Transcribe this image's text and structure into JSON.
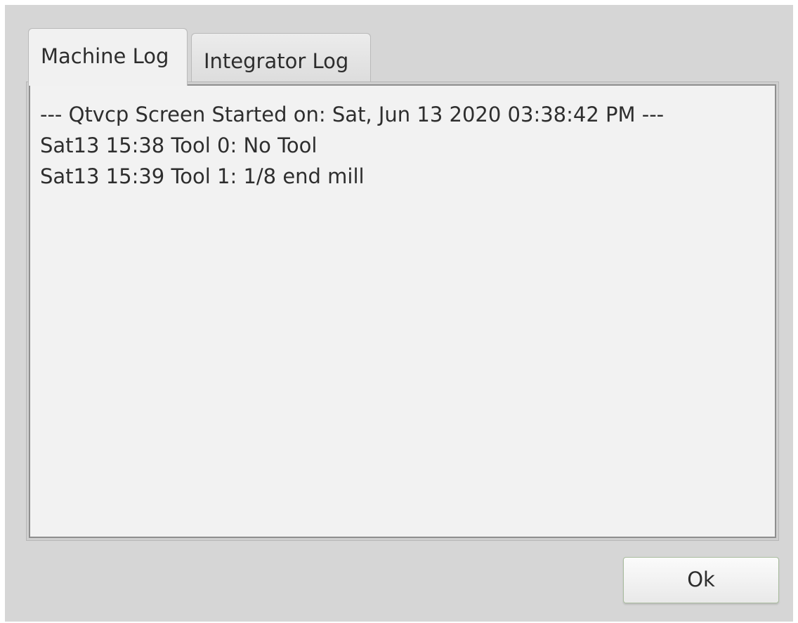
{
  "tabs": [
    {
      "label": "Machine Log",
      "active": true
    },
    {
      "label": "Integrator Log",
      "active": false
    }
  ],
  "log": {
    "lines": [
      "--- Qtvcp Screen Started on: Sat, Jun 13 2020 03:38:42 PM ---",
      "Sat13 15:38 Tool 0: No Tool",
      "Sat13 15:39 Tool 1: 1/8 end mill"
    ]
  },
  "buttons": {
    "ok_label": "Ok"
  },
  "colors": {
    "window_background": "#d6d6d6",
    "log_background": "#f2f2f2",
    "ok_border": "#a9bc9e"
  }
}
